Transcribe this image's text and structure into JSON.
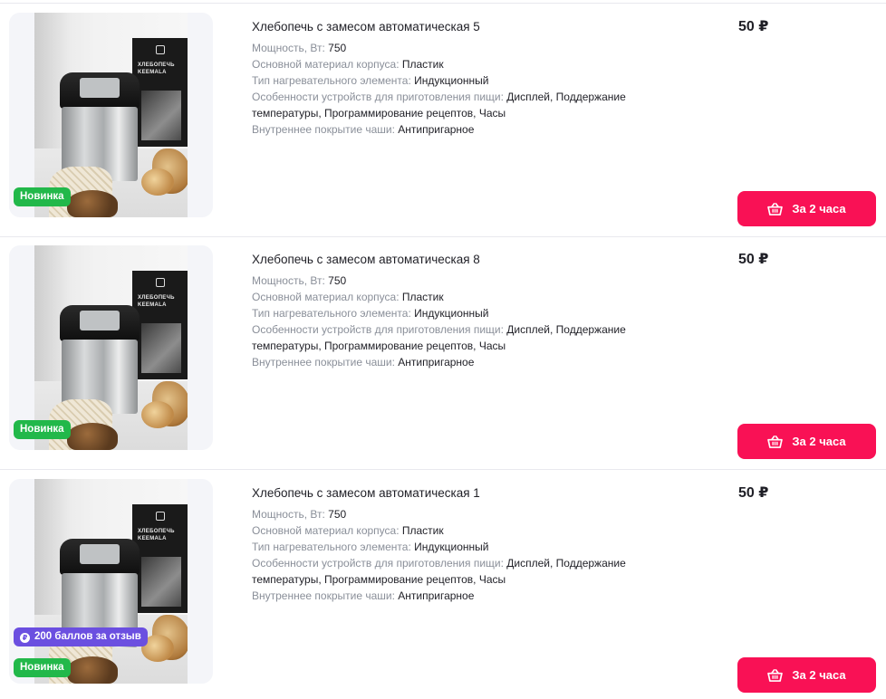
{
  "products": [
    {
      "title": "Хлебопечь с замесом автоматическая 5",
      "specs": [
        {
          "label": "Мощность, Вт: ",
          "value": "750"
        },
        {
          "label": "Основной материал корпуса: ",
          "value": "Пластик"
        },
        {
          "label": "Тип нагревательного элемента: ",
          "value": "Индукционный"
        },
        {
          "label": "Особенности устройств для приготовления пищи: ",
          "value": "Дисплей, Поддержание температуры, Программирование рецептов, Часы"
        },
        {
          "label": "Внутреннее покрытие чаши: ",
          "value": "Антипригарное"
        }
      ],
      "price": "50 ₽",
      "badge_new": "Новинка",
      "button_label": "За 2 часа"
    },
    {
      "title": "Хлебопечь с замесом автоматическая 8",
      "specs": [
        {
          "label": "Мощность, Вт: ",
          "value": "750"
        },
        {
          "label": "Основной материал корпуса: ",
          "value": "Пластик"
        },
        {
          "label": "Тип нагревательного элемента: ",
          "value": "Индукционный"
        },
        {
          "label": "Особенности устройств для приготовления пищи: ",
          "value": "Дисплей, Поддержание температуры, Программирование рецептов, Часы"
        },
        {
          "label": "Внутреннее покрытие чаши: ",
          "value": "Антипригарное"
        }
      ],
      "price": "50 ₽",
      "badge_new": "Новинка",
      "button_label": "За 2 часа"
    },
    {
      "title": "Хлебопечь с замесом автоматическая 1",
      "specs": [
        {
          "label": "Мощность, Вт: ",
          "value": "750"
        },
        {
          "label": "Основной материал корпуса: ",
          "value": "Пластик"
        },
        {
          "label": "Тип нагревательного элемента: ",
          "value": "Индукционный"
        },
        {
          "label": "Особенности устройств для приготовления пищи: ",
          "value": "Дисплей, Поддержание температуры, Программирование рецептов, Часы"
        },
        {
          "label": "Внутреннее покрытие чаши: ",
          "value": "Антипригарное"
        }
      ],
      "price": "50 ₽",
      "badge_new": "Новинка",
      "badge_points": "200 баллов за отзыв",
      "button_label": "За 2 часа"
    }
  ],
  "product_image_box_text": "ХЛЕБОПЕЧЬ KEEMALA",
  "colors": {
    "accent": "#f91155",
    "badge_new": "#22b84a",
    "badge_points": "#6b4fe0"
  },
  "icons": {
    "buy_button": "shopping-basket-icon",
    "points_badge": "coin-icon"
  }
}
